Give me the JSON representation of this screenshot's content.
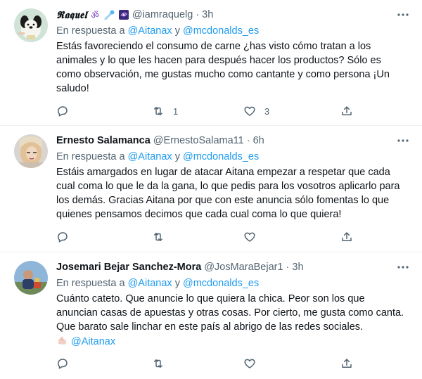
{
  "tweets": [
    {
      "display_name": "𝕽𝖆𝖖𝖚𝖊𝖑",
      "name_emojis": [
        "om-symbol-icon",
        "comet-icon",
        "galaxy-icon"
      ],
      "handle": "@iamraquelg",
      "separator": "·",
      "time": "3h",
      "reply_prefix": "En respuesta a",
      "reply_to_1": "@Aitanax",
      "reply_join": "y",
      "reply_to_2": "@mcdonalds_es",
      "text": "Estás favoreciendo el consumo de carne ¿has visto cómo tratan a los animales y lo que les hacen para después hacer los productos? Sólo es como observación, me gustas mucho como cantante y como persona ¡Un saludo!",
      "reply_count": "",
      "retweet_count": "1",
      "like_count": "3"
    },
    {
      "display_name": "Ernesto Salamanca",
      "handle": "@ErnestoSalama11",
      "separator": "·",
      "time": "6h",
      "reply_prefix": "En respuesta a",
      "reply_to_1": "@Aitanax",
      "reply_join": "y",
      "reply_to_2": "@mcdonalds_es",
      "text": "Estáis amargados en lugar de atacar  Aitana empezar a respetar que cada cual coma lo que le da la gana, lo que pedis para los vosotros aplicarlo para los demás. Gracias Aitana por que con este anuncia sólo fomentas lo que quienes pensamos decimos que cada cual coma lo que quiera!",
      "reply_count": "",
      "retweet_count": "",
      "like_count": ""
    },
    {
      "display_name": "Josemari Bejar Sanchez-Mora",
      "handle": "@JosMaraBejar1",
      "separator": "·",
      "time": "3h",
      "reply_prefix": "En respuesta a",
      "reply_to_1": "@Aitanax",
      "reply_join": "y",
      "reply_to_2": "@mcdonalds_es",
      "text": "Cuánto cateto. Que anuncie lo que quiera la chica. Peor son los que anuncian casas de apuestas y otras cosas. Por cierto, me gusta como canta. Que barato sale linchar en este país al abrigo de las redes sociales.",
      "text_emoji": "flexed-biceps-icon",
      "text_mention": "@Aitanax",
      "reply_count": "",
      "retweet_count": "",
      "like_count": ""
    }
  ],
  "colors": {
    "accent": "#1d9bf0",
    "secondary_text": "#536471",
    "primary_text": "#0f1419",
    "divider": "#eff3f4"
  }
}
